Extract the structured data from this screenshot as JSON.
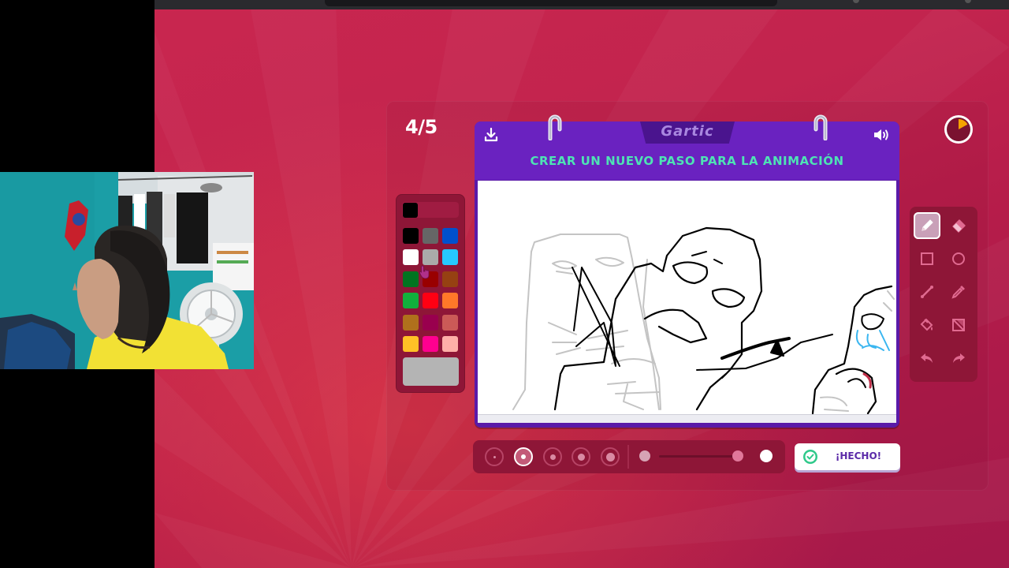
{
  "game": {
    "round": "4/5",
    "logo": "Gartic",
    "instruction": "CREAR UN NUEVO PASO PARA LA ANIMACIÓN",
    "done_label": "¡HECHO!",
    "timer_remaining_fraction": 0.83
  },
  "palette": {
    "current_color": "#000000",
    "selected_color": "#b4b4b4",
    "colors": [
      [
        "#000000",
        "#666666",
        "#0050cd"
      ],
      [
        "#ffffff",
        "#aaaaaa",
        "#26c9ff"
      ],
      [
        "#017420",
        "#990000",
        "#964112"
      ],
      [
        "#11b03c",
        "#ff0013",
        "#ff7829"
      ],
      [
        "#b0701c",
        "#99004e",
        "#cb5a57"
      ],
      [
        "#ffc126",
        "#ff008f",
        "#feafa8"
      ]
    ]
  },
  "tools": [
    "pencil-icon",
    "eraser-icon",
    "rectangle-icon",
    "ellipse-icon",
    "line-icon",
    "eyedropper-icon",
    "fill-icon",
    "clear-icon",
    "undo-icon",
    "redo-icon"
  ],
  "active_tool": "pencil-icon",
  "brush_sizes": [
    1,
    2,
    3,
    4,
    5
  ],
  "active_brush_size": 2,
  "opacity": 0.9,
  "colors": {
    "background": "#c2244e",
    "panel": "#8e1637",
    "card": "#6a22c0",
    "accent_text": "#4ee3b4"
  }
}
